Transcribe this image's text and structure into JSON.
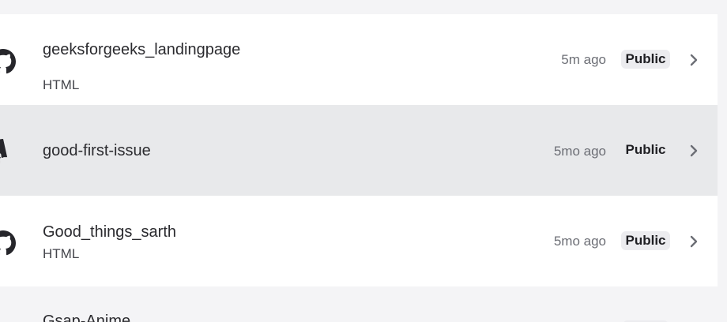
{
  "repos": [
    {
      "name": "geeksforgeeks_landingpage",
      "language": "HTML",
      "updated": "5m ago",
      "visibility": "Public",
      "icon": "github-icon"
    },
    {
      "name": "good-first-issue",
      "language": "",
      "updated": "5mo ago",
      "visibility": "Public",
      "icon": "github-icon"
    },
    {
      "name": "Good_things_sarth",
      "language": "HTML",
      "updated": "5mo ago",
      "visibility": "Public",
      "icon": "github-icon"
    },
    {
      "name": "Gsap-Anime",
      "icon": "github-icon"
    }
  ],
  "colors": {
    "row_bg": "#ffffff",
    "row_hover_bg": "#e8e9eb",
    "page_bg": "#f4f4f6",
    "badge_bg": "#ececef",
    "muted_text": "#6c6e75"
  }
}
